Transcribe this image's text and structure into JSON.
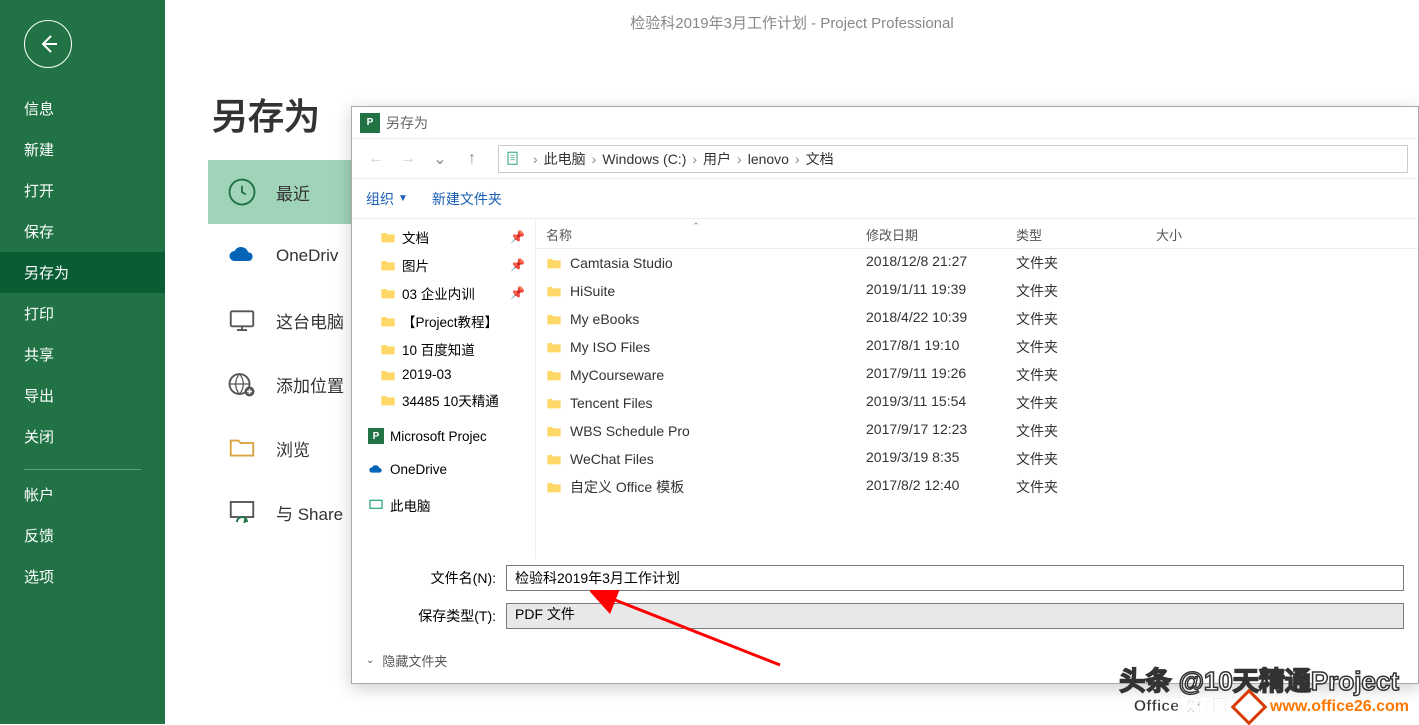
{
  "app_title": "检验科2019年3月工作计划  -  Project Professional",
  "page_title": "另存为",
  "sidebar": {
    "items": [
      {
        "label": "信息"
      },
      {
        "label": "新建"
      },
      {
        "label": "打开"
      },
      {
        "label": "保存"
      },
      {
        "label": "另存为"
      },
      {
        "label": "打印"
      },
      {
        "label": "共享"
      },
      {
        "label": "导出"
      },
      {
        "label": "关闭"
      }
    ],
    "bottom": [
      {
        "label": "帐户"
      },
      {
        "label": "反馈"
      },
      {
        "label": "选项"
      }
    ]
  },
  "saveas_targets": [
    {
      "label": "最近"
    },
    {
      "label": "OneDriv"
    },
    {
      "label": "这台电脑"
    },
    {
      "label": "添加位置"
    },
    {
      "label": "浏览"
    },
    {
      "label": "与 Share"
    }
  ],
  "dialog": {
    "title": "另存为",
    "breadcrumb": [
      "此电脑",
      "Windows (C:)",
      "用户",
      "lenovo",
      "文档"
    ],
    "toolbar": {
      "organize": "组织",
      "newfolder": "新建文件夹"
    },
    "tree": [
      {
        "label": "文档",
        "pinned": true
      },
      {
        "label": "图片",
        "pinned": true
      },
      {
        "label": "03 企业内训",
        "pinned": true
      },
      {
        "label": "【Project教程】",
        "pinned": false
      },
      {
        "label": "10 百度知道",
        "pinned": false
      },
      {
        "label": "2019-03",
        "pinned": false
      },
      {
        "label": "34485 10天精通",
        "pinned": false
      },
      {
        "label": "Microsoft Projec",
        "project": true
      },
      {
        "label": "OneDrive",
        "onedrive": true
      },
      {
        "label": "此电脑",
        "pc": true
      }
    ],
    "columns": {
      "name": "名称",
      "date": "修改日期",
      "type": "类型",
      "size": "大小"
    },
    "rows": [
      {
        "name": "Camtasia Studio",
        "date": "2018/12/8 21:27",
        "type": "文件夹"
      },
      {
        "name": "HiSuite",
        "date": "2019/1/11 19:39",
        "type": "文件夹"
      },
      {
        "name": "My eBooks",
        "date": "2018/4/22 10:39",
        "type": "文件夹"
      },
      {
        "name": "My ISO Files",
        "date": "2017/8/1 19:10",
        "type": "文件夹"
      },
      {
        "name": "MyCourseware",
        "date": "2017/9/11 19:26",
        "type": "文件夹"
      },
      {
        "name": "Tencent Files",
        "date": "2019/3/11 15:54",
        "type": "文件夹"
      },
      {
        "name": "WBS Schedule Pro",
        "date": "2017/9/17 12:23",
        "type": "文件夹"
      },
      {
        "name": "WeChat Files",
        "date": "2019/3/19 8:35",
        "type": "文件夹"
      },
      {
        "name": "自定义 Office 模板",
        "date": "2017/8/2 12:40",
        "type": "文件夹"
      }
    ],
    "form": {
      "filename_label": "文件名(N):",
      "filename_value": "检验科2019年3月工作计划",
      "filetype_label": "保存类型(T):",
      "filetype_value": "PDF 文件",
      "hide_folders": "隐藏文件夹"
    }
  },
  "watermark1": "头条 @10天精通Project",
  "watermark2": "www.office26.com",
  "watermark2_prefix": "Office教程网"
}
